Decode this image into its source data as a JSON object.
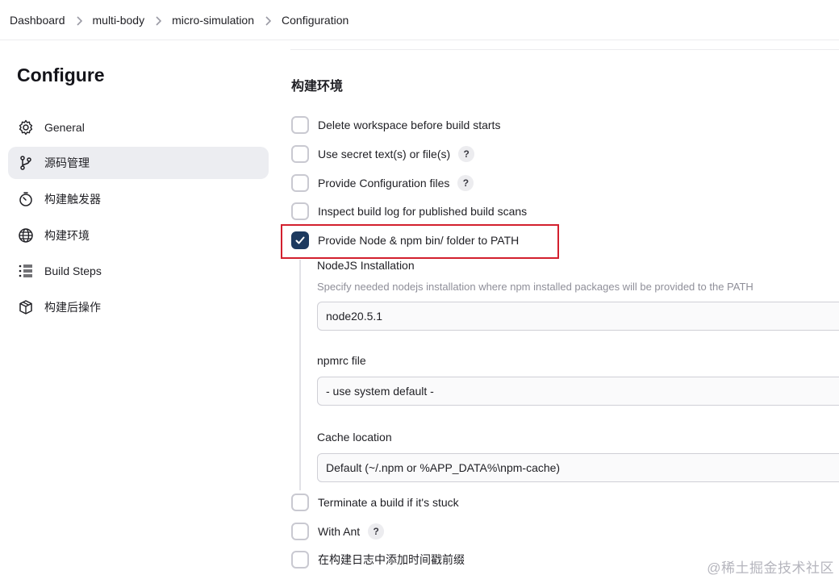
{
  "breadcrumb": [
    "Dashboard",
    "multi-body",
    "micro-simulation",
    "Configuration"
  ],
  "sidebar": {
    "title": "Configure",
    "items": [
      {
        "label": "General",
        "icon": "gear-icon"
      },
      {
        "label": "源码管理",
        "icon": "branch-icon",
        "active": true
      },
      {
        "label": "构建触发器",
        "icon": "timer-icon"
      },
      {
        "label": "构建环境",
        "icon": "globe-icon"
      },
      {
        "label": "Build Steps",
        "icon": "list-icon"
      },
      {
        "label": "构建后操作",
        "icon": "box-icon"
      }
    ]
  },
  "main": {
    "section_title": "构建环境",
    "options": [
      {
        "label": "Delete workspace before build starts",
        "checked": false,
        "help": false
      },
      {
        "label": "Use secret text(s) or file(s)",
        "checked": false,
        "help": true
      },
      {
        "label": "Provide Configuration files",
        "checked": false,
        "help": true
      },
      {
        "label": "Inspect build log for published build scans",
        "checked": false,
        "help": false
      },
      {
        "label": "Provide Node & npm bin/ folder to PATH",
        "checked": true,
        "help": false
      }
    ],
    "node": {
      "installation_label": "NodeJS Installation",
      "installation_desc": "Specify needed nodejs installation where npm installed packages will be provided to the PATH",
      "installation_value": "node20.5.1",
      "npmrc_label": "npmrc file",
      "npmrc_value": "- use system default -",
      "cache_label": "Cache location",
      "cache_value": "Default (~/.npm or %APP_DATA%\\npm-cache)"
    },
    "options_after": [
      {
        "label": "Terminate a build if it's stuck",
        "checked": false,
        "help": false
      },
      {
        "label": "With Ant",
        "checked": false,
        "help": true
      },
      {
        "label": "在构建日志中添加时间戳前缀",
        "checked": false,
        "help": false
      }
    ],
    "help_glyph": "?"
  },
  "watermark": "@稀土掘金技术社区",
  "colors": {
    "accent": "#1d3a5f",
    "highlight": "#d3202e",
    "active_bg": "#ecedf1"
  }
}
